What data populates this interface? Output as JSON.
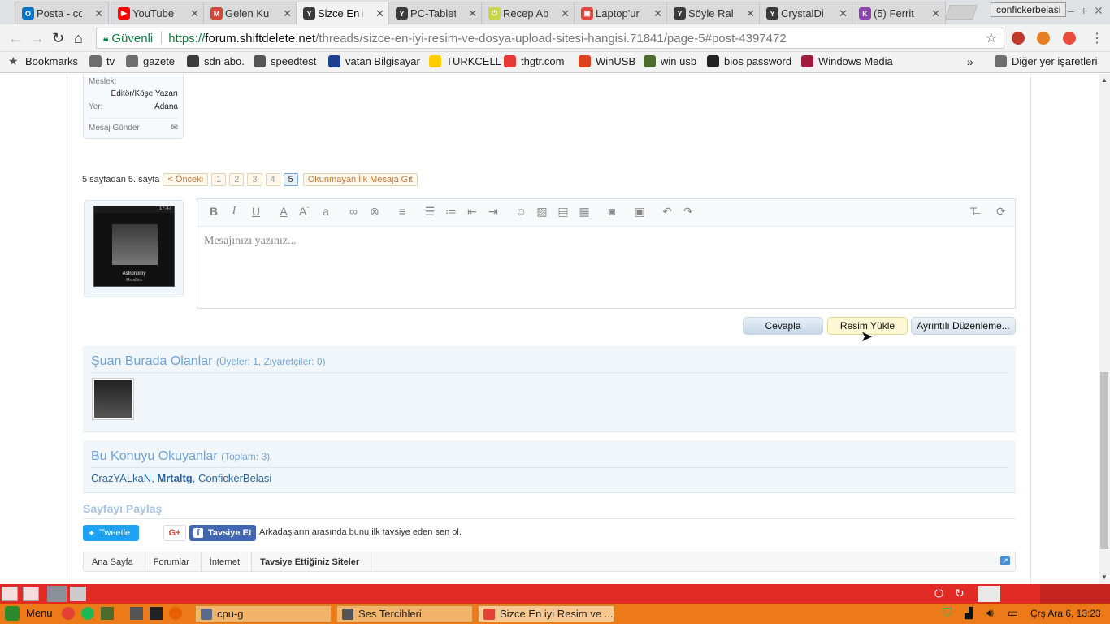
{
  "browser": {
    "tabs": [
      {
        "title": "Posta - co",
        "icon": "outlook-icon",
        "color": "#0072c6",
        "glyph": "O"
      },
      {
        "title": "YouTube",
        "icon": "youtube-icon",
        "color": "#ff0000",
        "glyph": "▶"
      },
      {
        "title": "Gelen Ku",
        "icon": "gmail-icon",
        "color": "#d44638",
        "glyph": "M"
      },
      {
        "title": "Sizce En i",
        "icon": "shiftdelete-icon",
        "color": "#3b3b3b",
        "glyph": "Y"
      },
      {
        "title": "PC-Tablet",
        "icon": "shiftdelete-icon",
        "color": "#3b3b3b",
        "glyph": "Y"
      },
      {
        "title": "Recep Ab",
        "icon": "power-icon",
        "color": "#c9d64a",
        "glyph": "⏻"
      },
      {
        "title": "Laptop'ur",
        "icon": "clip-icon",
        "color": "#e0463e",
        "glyph": "▣"
      },
      {
        "title": "Söyle Ral",
        "icon": "shiftdelete-icon",
        "color": "#3b3b3b",
        "glyph": "Y"
      },
      {
        "title": "CrystalDi",
        "icon": "shiftdelete-icon",
        "color": "#3b3b3b",
        "glyph": "Y"
      },
      {
        "title": "(5) Ferrit",
        "icon": "kizlarsoruyor-icon",
        "color": "#8e44ad",
        "glyph": "K"
      }
    ],
    "profile_name": "confickerbelasi",
    "secure_label": "Güvenli",
    "url": {
      "scheme": "https://",
      "host": "forum.shiftdelete.net",
      "path": "/threads/sizce-en-iyi-resim-ve-dosya-upload-sitesi-hangisi.71841/page-5#post-4397472"
    },
    "bookmarks": [
      {
        "label": "Bookmarks",
        "icon": "star-icon"
      },
      {
        "label": "tv",
        "icon": "folder-icon"
      },
      {
        "label": "gazete",
        "icon": "folder-icon"
      },
      {
        "label": "sdn abo.",
        "icon": "shiftdelete-icon"
      },
      {
        "label": "speedtest",
        "icon": "speedometer-icon"
      },
      {
        "label": "vatan Bilgisayar",
        "icon": "vatan-icon"
      },
      {
        "label": "TURKCELL",
        "icon": "turkcell-icon"
      },
      {
        "label": "thgtr.com",
        "icon": "thg-icon"
      },
      {
        "label": "WinUSB",
        "icon": "ask-icon"
      },
      {
        "label": "win usb",
        "icon": "winusb-icon"
      },
      {
        "label": "bios password",
        "icon": "bios-icon"
      },
      {
        "label": "Windows Media",
        "icon": "media-icon"
      }
    ],
    "bookmarks_other": "Diğer yer işaretleri"
  },
  "profile_card": {
    "occupation_label": "Meslek:",
    "occupation": "Editör/Köşe Yazarı",
    "location_label": "Yer:",
    "location": "Adana",
    "send_message": "Mesaj Gönder"
  },
  "pagination": {
    "summary": "5 sayfadan 5. sayfa",
    "prev": "< Önceki",
    "pages": [
      "1",
      "2",
      "3",
      "4",
      "5"
    ],
    "unread": "Okunmayan İlk Mesaja Git"
  },
  "avatar": {
    "song": "Astronomy",
    "artist": "Metallica",
    "time": "17:47"
  },
  "editor": {
    "placeholder": "Mesajınızı yazınız..."
  },
  "buttons": {
    "reply": "Cevapla",
    "upload_image": "Resim Yükle",
    "advanced": "Ayrıntılı Düzenleme..."
  },
  "online": {
    "title": "Şuan Burada Olanlar",
    "counts": "(Üyeler: 1, Ziyaretçiler: 0)"
  },
  "readers": {
    "title": "Bu Konuyu Okuyanlar",
    "total": "(Toplam: 3)",
    "users": [
      "CrazYALkaN",
      "Mrtaltg",
      "ConfickerBelasi"
    ]
  },
  "share": {
    "title": "Sayfayı Paylaş",
    "tweet": "Tweetle",
    "gplus": "G+",
    "fb_recommend": "Tavsiye Et",
    "fb_text": "Arkadaşların arasında bunu ilk tavsiye eden sen ol."
  },
  "breadcrumb": [
    "Ana Sayfa",
    "Forumlar",
    "İnternet",
    "Tavsiye Ettiğiniz Siteler"
  ],
  "taskbar": {
    "menu": "Menu",
    "windows": [
      "cpu-g",
      "Ses Tercihleri",
      "Sizce En iyi Resim ve ..."
    ],
    "clock": "Çrş Ara  6, 13:23"
  },
  "colors": {
    "accent": "#6fa3d6",
    "panel_red": "#e32b26",
    "panel_orange": "#ed7a19"
  }
}
